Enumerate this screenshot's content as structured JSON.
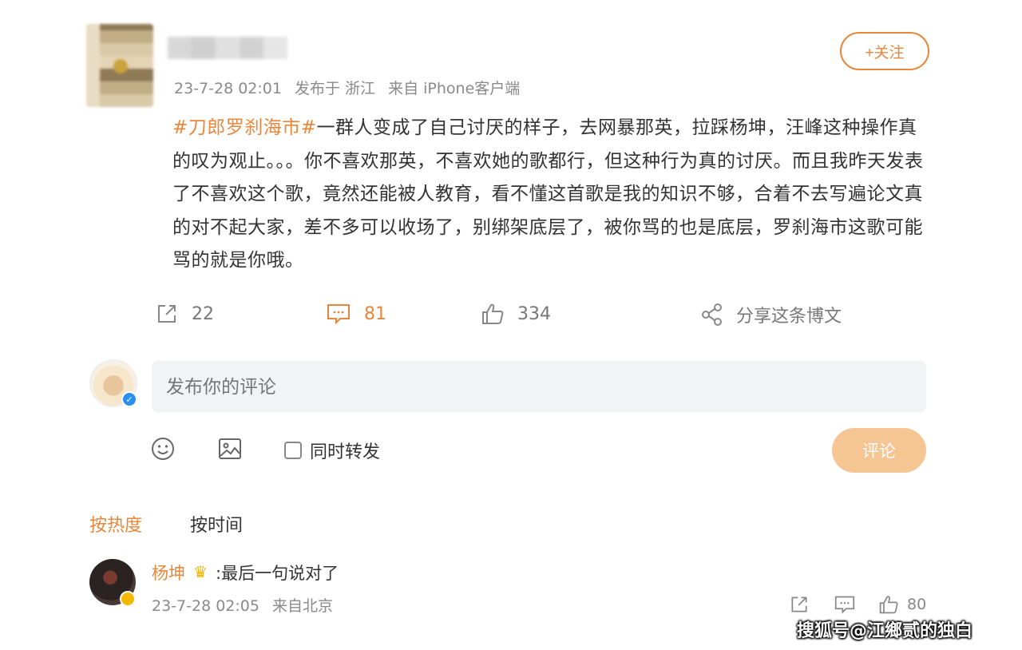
{
  "post": {
    "meta": {
      "time": "23-7-28 02:01",
      "location": "发布于 浙江",
      "source": "来自 iPhone客户端"
    },
    "follow_label": "+关注",
    "topic": "#刀郎罗刹海市#",
    "text": "一群人变成了自己讨厌的样子，去网暴那英，拉踩杨坤，汪峰这种操作真的叹为观止。。。你不喜欢那英，不喜欢她的歌都行，但这种行为真的讨厌。而且我昨天发表了不喜欢这个歌，竟然还能被人教育，看不懂这首歌是我的知识不够，合着不去写遍论文真的对不起大家，差不多可以收场了，别绑架底层了，被你骂的也是底层，罗刹海市这歌可能骂的就是你哦。"
  },
  "actions": {
    "repost_count": "22",
    "comment_count": "81",
    "like_count": "334",
    "share_label": "分享这条博文"
  },
  "composer": {
    "placeholder": "发布你的评论",
    "repost_label": "同时转发",
    "submit_label": "评论"
  },
  "sort": {
    "hot_label": "按热度",
    "time_label": "按时间"
  },
  "comments": [
    {
      "user": "杨坤",
      "text": ":最后一句说对了",
      "time": "23-7-28 02:05",
      "source": "来自北京",
      "like_count": "80"
    }
  ],
  "watermark": "搜狐号@江鄉贰的独白",
  "colors": {
    "accent": "#e8873a",
    "submit_disabled": "#f6c594",
    "input_bg": "#f2f3f5",
    "verified_blue": "#2a8ff0"
  },
  "icons": [
    "repost-icon",
    "comment-icon",
    "like-icon",
    "share-icon",
    "emoji-icon",
    "image-icon",
    "crown-icon",
    "verified-icon"
  ]
}
